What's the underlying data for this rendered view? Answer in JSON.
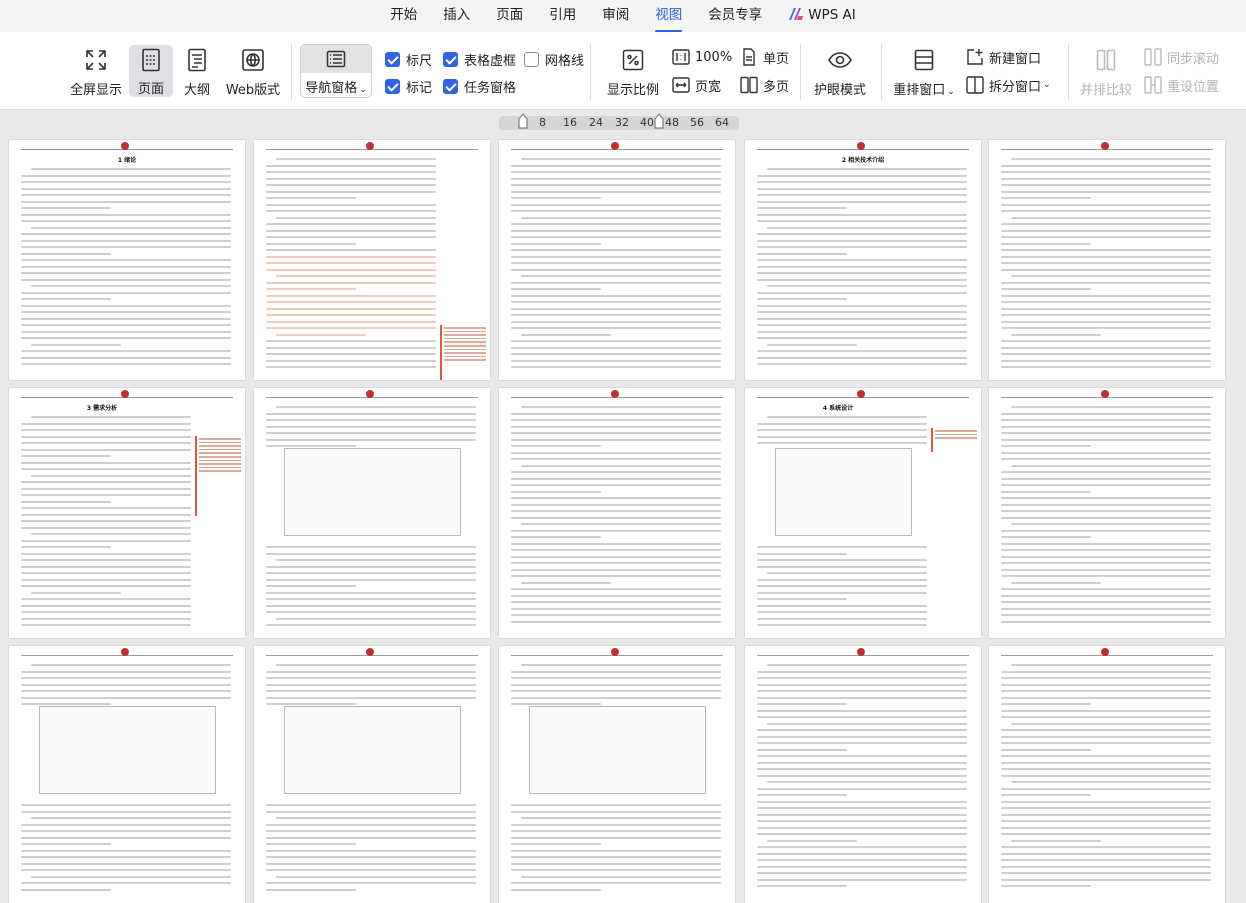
{
  "menu": {
    "items": [
      "开始",
      "插入",
      "页面",
      "引用",
      "审阅",
      "视图",
      "会员专享",
      "WPS AI"
    ],
    "active_index": 5
  },
  "ribbon": {
    "fullscreen": "全屏显示",
    "page": "页面",
    "outline": "大纲",
    "web": "Web版式",
    "nav_pane": "导航窗格",
    "ruler": "标尺",
    "table_gridlines": "表格虚框",
    "gridlines": "网格线",
    "markers": "标记",
    "task_pane": "任务窗格",
    "zoom": "显示比例",
    "zoom_100": "100%",
    "page_width": "页宽",
    "single_page": "单页",
    "multi_page": "多页",
    "eye_care": "护眼模式",
    "rearrange": "重排窗口",
    "new_window": "新建窗口",
    "split_window": "拆分窗口",
    "side_by_side": "并排比较",
    "sync_scroll": "同步滚动",
    "reset_position": "重设位置"
  },
  "checkboxes": {
    "ruler": true,
    "table_gridlines": true,
    "gridlines": false,
    "markers": true,
    "task_pane": true
  },
  "pages_per_row_slider": {
    "ticks": [
      "8",
      "16",
      "24",
      "32",
      "40",
      "48",
      "56",
      "64"
    ],
    "value": "40"
  },
  "pages": {
    "titles": [
      "1 绪论",
      "",
      "",
      "2 相关技术介绍",
      "",
      "3 需求分析",
      "",
      "",
      "4 系统设计",
      "",
      "",
      "",
      "",
      "",
      ""
    ]
  },
  "colors": {
    "accent": "#2f5fe3",
    "checkbox": "#2f64e8",
    "comment_marker": "#e05a3a",
    "highlight": "#f1c9bd"
  }
}
